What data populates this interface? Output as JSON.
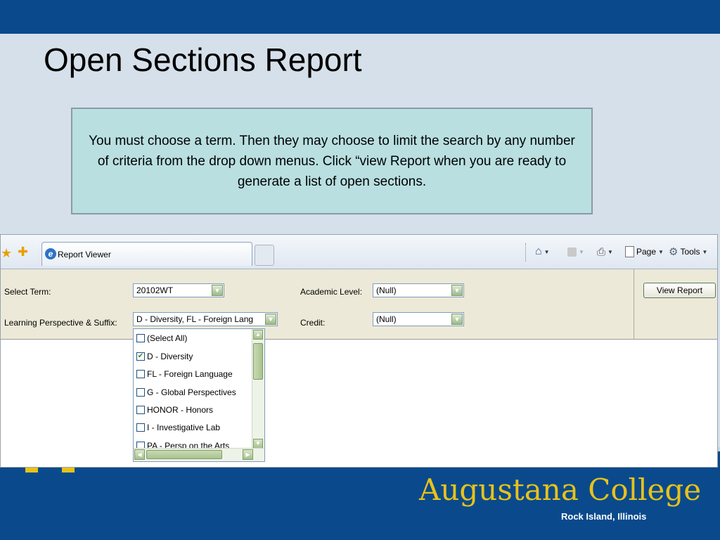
{
  "slide": {
    "title": "Open Sections Report",
    "callout": "You must choose a term. Then they may choose to limit the search by any number of criteria from the drop down menus. Click “view Report when you are ready to generate a list of open sections."
  },
  "browser": {
    "tab_label": "Report Viewer",
    "toolbar": {
      "page_label": "Page",
      "tools_label": "Tools"
    }
  },
  "params": {
    "term_label": "Select Term:",
    "term_value": "20102WT",
    "lp_label": "Learning Perspective & Suffix:",
    "lp_value": "D - Diversity, FL - Foreign Lang",
    "academic_level_label": "Academic Level:",
    "academic_level_value": "(Null)",
    "credit_label": "Credit:",
    "credit_value": "(Null)",
    "view_report_label": "View Report"
  },
  "dropdown": {
    "options": [
      {
        "label": "(Select All)",
        "checked": false
      },
      {
        "label": "D - Diversity",
        "checked": true
      },
      {
        "label": "FL - Foreign Language",
        "checked": false
      },
      {
        "label": "G - Global Perspectives",
        "checked": false
      },
      {
        "label": "HONOR - Honors",
        "checked": false
      },
      {
        "label": "I - Investigative Lab",
        "checked": false
      },
      {
        "label": "PA - Persp on the Arts",
        "checked": false
      }
    ]
  },
  "footer": {
    "college_name": "Augustana College",
    "location": "Rock Island, Illinois"
  },
  "colors": {
    "brand_blue": "#0a4a8c",
    "brand_gold": "#e7c21a",
    "callout_bg": "#b9dfe1"
  }
}
